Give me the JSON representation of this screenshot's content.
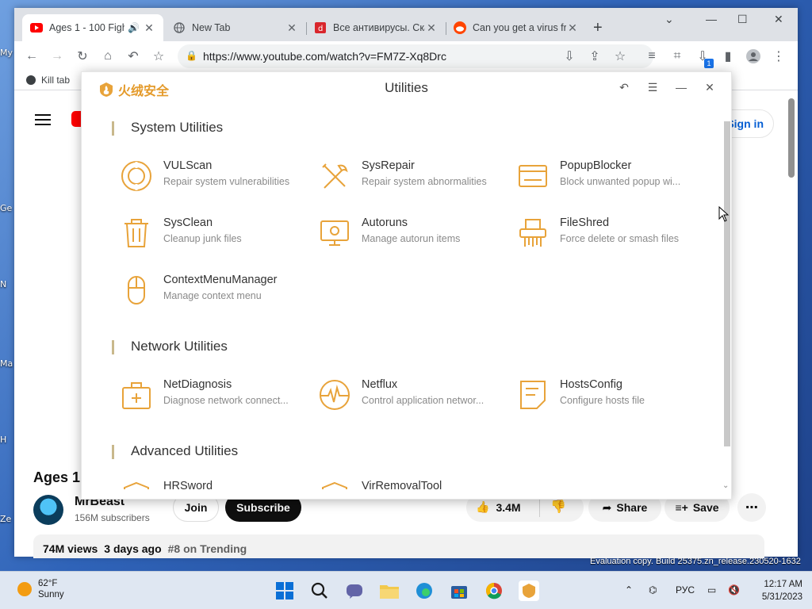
{
  "browser": {
    "tabs": [
      {
        "title": "Ages 1 - 100 Figh",
        "icon": "youtube-icon",
        "audio": true
      },
      {
        "title": "New Tab",
        "icon": "globe-icon"
      },
      {
        "title": "Все антивирусы. Ска",
        "icon": "antivirus-site-icon"
      },
      {
        "title": "Can you get a virus fr",
        "icon": "reddit-icon"
      }
    ],
    "url": "https://www.youtube.com/watch?v=FM7Z-Xq8Drc",
    "bookmark": "Kill tab",
    "download_badge": "1"
  },
  "youtube": {
    "signin": "Sign in",
    "video_title": "Ages 1",
    "channel_name": "MrBeast",
    "subscribers": "156M subscribers",
    "join": "Join",
    "subscribe": "Subscribe",
    "likes": "3.4M",
    "share": "Share",
    "save": "Save",
    "views": "74M views",
    "age": "3 days ago",
    "trending": "#8 on Trending"
  },
  "dialog": {
    "brand": "火绒安全",
    "title": "Utilities",
    "sections": [
      {
        "title": "System Utilities"
      },
      {
        "title": "Network Utilities"
      },
      {
        "title": "Advanced Utilities"
      }
    ],
    "system_utilities": [
      {
        "name": "VULScan",
        "desc": "Repair system vulnerabilities",
        "icon": "vulscan-icon"
      },
      {
        "name": "SysRepair",
        "desc": "Repair system abnormalities",
        "icon": "wrench-screwdriver-icon"
      },
      {
        "name": "PopupBlocker",
        "desc": "Block unwanted popup wi...",
        "icon": "popup-window-icon"
      },
      {
        "name": "SysClean",
        "desc": "Cleanup junk files",
        "icon": "trash-icon"
      },
      {
        "name": "Autoruns",
        "desc": "Manage autorun items",
        "icon": "monitor-icon"
      },
      {
        "name": "FileShred",
        "desc": "Force delete or smash files",
        "icon": "shredder-icon"
      },
      {
        "name": "ContextMenuManager",
        "desc": "Manage context menu",
        "icon": "mouse-icon"
      }
    ],
    "network_utilities": [
      {
        "name": "NetDiagnosis",
        "desc": "Diagnose network connect...",
        "icon": "medkit-icon"
      },
      {
        "name": "Netflux",
        "desc": "Control application networ...",
        "icon": "pulse-icon"
      },
      {
        "name": "HostsConfig",
        "desc": "Configure hosts file",
        "icon": "document-icon"
      }
    ],
    "advanced_utilities": [
      {
        "name": "HRSword",
        "icon": "shield-icon"
      },
      {
        "name": "VirRemovalTool",
        "icon": "shield-icon"
      }
    ]
  },
  "taskbar": {
    "temperature": "62°F",
    "weather": "Sunny",
    "language": "РУС",
    "time": "12:17 AM",
    "date": "5/31/2023"
  },
  "watermark": "Evaluation copy. Build 25375.zn_release.230520-1632",
  "desktop_labels": [
    "My",
    "Ge",
    "N",
    "Ma",
    "H",
    "Ze"
  ],
  "accent": "#e8a33a"
}
